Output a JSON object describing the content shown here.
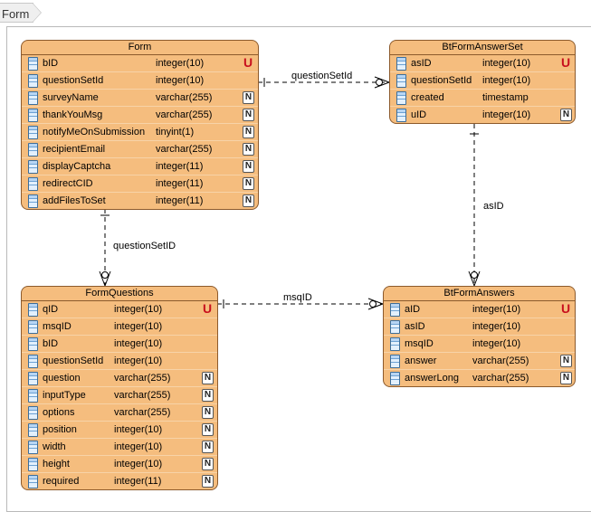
{
  "tab": {
    "label": "Form"
  },
  "relationships": [
    {
      "label": "questionSetId"
    },
    {
      "label": "asID"
    },
    {
      "label": "questionSetID"
    },
    {
      "label": "msqID"
    }
  ],
  "entities": [
    {
      "title": "Form",
      "columns": [
        {
          "name": "bID",
          "type": "integer(10)",
          "badge": "U"
        },
        {
          "name": "questionSetId",
          "type": "integer(10)",
          "badge": ""
        },
        {
          "name": "surveyName",
          "type": "varchar(255)",
          "badge": "N"
        },
        {
          "name": "thankYouMsg",
          "type": "varchar(255)",
          "badge": "N"
        },
        {
          "name": "notifyMeOnSubmission",
          "type": "tinyint(1)",
          "badge": "N"
        },
        {
          "name": "recipientEmail",
          "type": "varchar(255)",
          "badge": "N"
        },
        {
          "name": "displayCaptcha",
          "type": "integer(11)",
          "badge": "N"
        },
        {
          "name": "redirectCID",
          "type": "integer(11)",
          "badge": "N"
        },
        {
          "name": "addFilesToSet",
          "type": "integer(11)",
          "badge": "N"
        }
      ]
    },
    {
      "title": "BtFormAnswerSet",
      "columns": [
        {
          "name": "asID",
          "type": "integer(10)",
          "badge": "U"
        },
        {
          "name": "questionSetId",
          "type": "integer(10)",
          "badge": ""
        },
        {
          "name": "created",
          "type": "timestamp",
          "badge": ""
        },
        {
          "name": "uID",
          "type": "integer(10)",
          "badge": "N"
        }
      ]
    },
    {
      "title": "FormQuestions",
      "columns": [
        {
          "name": "qID",
          "type": "integer(10)",
          "badge": "U"
        },
        {
          "name": "msqID",
          "type": "integer(10)",
          "badge": ""
        },
        {
          "name": "bID",
          "type": "integer(10)",
          "badge": ""
        },
        {
          "name": "questionSetId",
          "type": "integer(10)",
          "badge": ""
        },
        {
          "name": "question",
          "type": "varchar(255)",
          "badge": "N"
        },
        {
          "name": "inputType",
          "type": "varchar(255)",
          "badge": "N"
        },
        {
          "name": "options",
          "type": "varchar(255)",
          "badge": "N"
        },
        {
          "name": "position",
          "type": "integer(10)",
          "badge": "N"
        },
        {
          "name": "width",
          "type": "integer(10)",
          "badge": "N"
        },
        {
          "name": "height",
          "type": "integer(10)",
          "badge": "N"
        },
        {
          "name": "required",
          "type": "integer(11)",
          "badge": "N"
        }
      ]
    },
    {
      "title": "BtFormAnswers",
      "columns": [
        {
          "name": "aID",
          "type": "integer(10)",
          "badge": "U"
        },
        {
          "name": "asID",
          "type": "integer(10)",
          "badge": ""
        },
        {
          "name": "msqID",
          "type": "integer(10)",
          "badge": ""
        },
        {
          "name": "answer",
          "type": "varchar(255)",
          "badge": "N"
        },
        {
          "name": "answerLong",
          "type": "varchar(255)",
          "badge": "N"
        }
      ]
    }
  ]
}
